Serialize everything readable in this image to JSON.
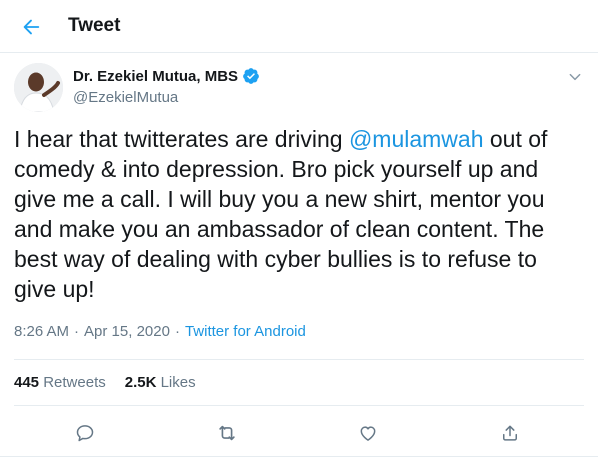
{
  "header": {
    "title": "Tweet"
  },
  "author": {
    "name": "Dr. Ezekiel Mutua, MBS",
    "handle": "@EzekielMutua"
  },
  "tweet": {
    "text_before": "I hear that twitterates are driving ",
    "mention": "@mulamwah",
    "text_after": " out of comedy & into depression. Bro pick yourself up and give me a call. I will buy you a new shirt, mentor you and make you an ambassador of clean content. The best way of dealing with cyber bullies is to refuse to give up!"
  },
  "meta": {
    "time": "8:26 AM",
    "separator": "·",
    "date": "Apr 15, 2020",
    "source": "Twitter for Android"
  },
  "stats": {
    "retweets_count": "445",
    "retweets_label": "Retweets",
    "likes_count": "2.5K",
    "likes_label": "Likes"
  },
  "colors": {
    "accent": "#1da1f2",
    "link": "#1b95e0",
    "secondary_text": "#657786",
    "border": "#e6ecf0"
  },
  "icons": {
    "back": "arrow-left-icon",
    "verified": "verified-badge-icon",
    "more": "chevron-down-icon",
    "reply": "reply-icon",
    "retweet": "retweet-icon",
    "like": "heart-icon",
    "share": "share-icon"
  }
}
